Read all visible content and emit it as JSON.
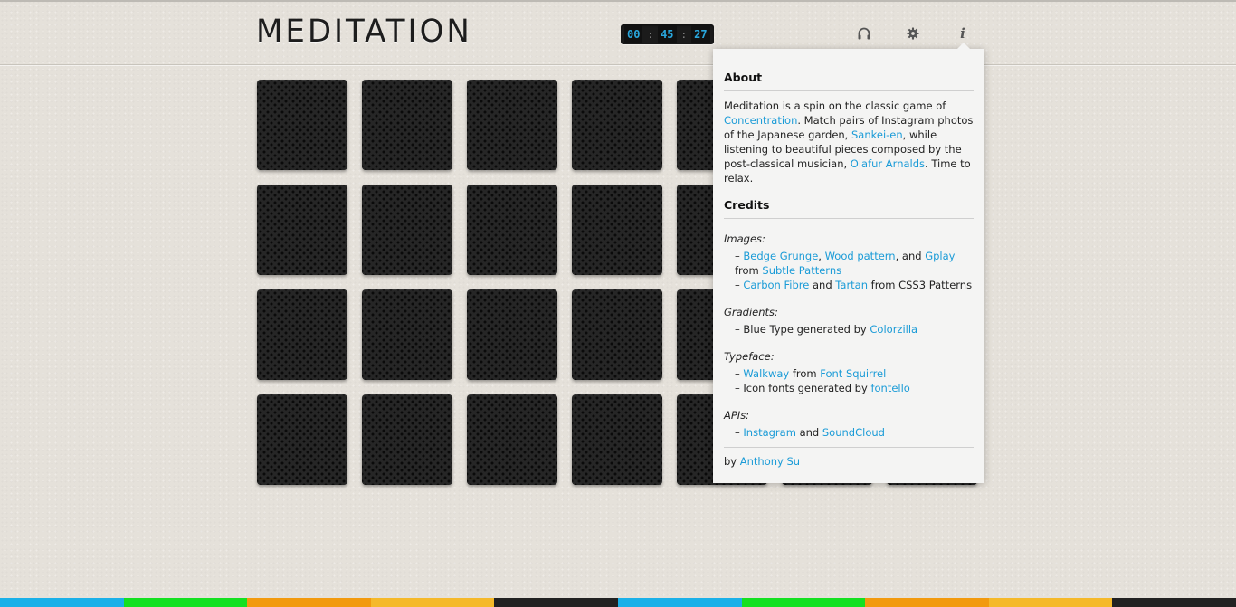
{
  "header": {
    "title": "MEDITATION",
    "timer": {
      "hours": "00",
      "minutes": "45",
      "seconds": "27",
      "separator": ":"
    },
    "icons": [
      "headphones-icon",
      "gear-icon",
      "info-icon"
    ]
  },
  "grid": {
    "rows": 4,
    "columns": 7,
    "tile_state": "face-down"
  },
  "popover": {
    "about_heading": "About",
    "about": {
      "t1": "Meditation is a spin on the classic game of ",
      "link_concentration": "Concentration",
      "t2": ". Match pairs of Instagram photos of the Japanese garden, ",
      "link_sankei": "Sankei-en",
      "t3": ", while listening to beautiful pieces composed by the post-classical musician, ",
      "link_olafur": "Olafur Arnalds",
      "t4": ". Time to relax."
    },
    "credits_heading": "Credits",
    "images": {
      "label": "Images:",
      "dash": "– ",
      "link_bedge": "Bedge Grunge",
      "comma": ", ",
      "link_wood": "Wood pattern",
      "and1": ", and ",
      "link_gplay": "Gplay",
      "from1": "from ",
      "link_subtle": "Subtle Patterns",
      "link_carbon": "Carbon Fibre",
      "and2": " and ",
      "link_tartan": "Tartan",
      "from2": " from CSS3 Patterns"
    },
    "gradients": {
      "label": "Gradients:",
      "text": "– Blue Type generated by ",
      "link_colorzilla": "Colorzilla"
    },
    "typeface": {
      "label": "Typeface:",
      "dash": "– ",
      "link_walkway": "Walkway",
      "from": " from ",
      "link_fontsquirrel": "Font Squirrel",
      "icon_text": "– Icon fonts generated by ",
      "link_fontello": "fontello"
    },
    "apis": {
      "label": "APIs:",
      "dash": "– ",
      "link_instagram": "Instagram",
      "and": " and ",
      "link_soundcloud": "SoundCloud"
    },
    "byline": {
      "by": "by ",
      "link_author": "Anthony Su"
    }
  },
  "colors": {
    "accent_link": "#1a9bd7",
    "timer_digits": "#29a6dc",
    "stripes": [
      "#1ab0e8",
      "#14e021",
      "#f29a0e",
      "#f5b92a",
      "#222222",
      "#1ab0e8",
      "#14e021",
      "#f29a0e",
      "#f5b92a",
      "#222222"
    ]
  }
}
